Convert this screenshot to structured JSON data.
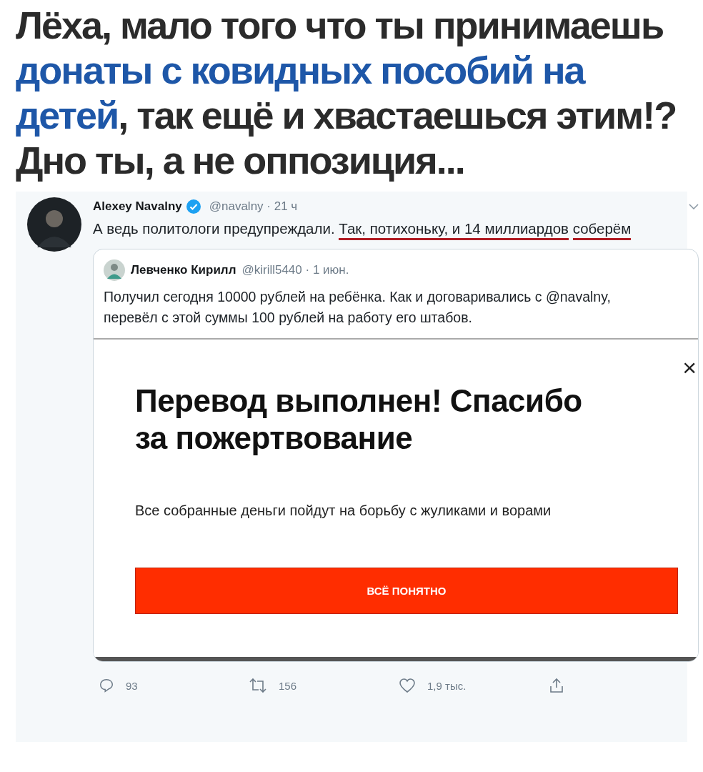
{
  "caption": {
    "lines": [
      [
        {
          "text": "Лёха, мало того что ты принимаешь",
          "highlight": false
        }
      ],
      [
        {
          "text": "донаты с ковидных пособий на",
          "highlight": true
        }
      ],
      [
        {
          "text": "детей",
          "highlight": true
        },
        {
          "text": ", так ещё и хвастаешься этим!?",
          "highlight": false
        }
      ],
      [
        {
          "text": "Дно ты, а не оппозиция...",
          "highlight": false
        }
      ]
    ]
  },
  "tweet": {
    "author": "Alexey Navalny",
    "verified": true,
    "handle": "@navalny · 21 ч",
    "text": [
      {
        "text": "А ведь политологи предупреждали.",
        "underlined": false
      },
      {
        "text": "Так, потихоньку, и 14 миллиардов",
        "underlined": true
      },
      {
        "text": "соберём",
        "underlined": true
      }
    ],
    "quote": {
      "author": "Левченко Кирилл",
      "handle": "@kirill5440 · 1 июн.",
      "text": "Получил сегодня 10000 рублей на ребёнка. Как и договаривались с @navalny, перевёл с этой суммы 100 рублей на работу его штабов.",
      "dialog": {
        "close": "×",
        "title": "Перевод выполнен! Спасибо за пожертвование",
        "message": "Все собранные деньги пойдут на борьбу с жуликами и ворами",
        "button": "ВСЁ ПОНЯТНО"
      }
    },
    "actions": [
      {
        "kind": "reply",
        "count": "93"
      },
      {
        "kind": "retweet",
        "count": "156"
      },
      {
        "kind": "like",
        "count": "1,9 тыс."
      },
      {
        "kind": "share"
      }
    ]
  }
}
